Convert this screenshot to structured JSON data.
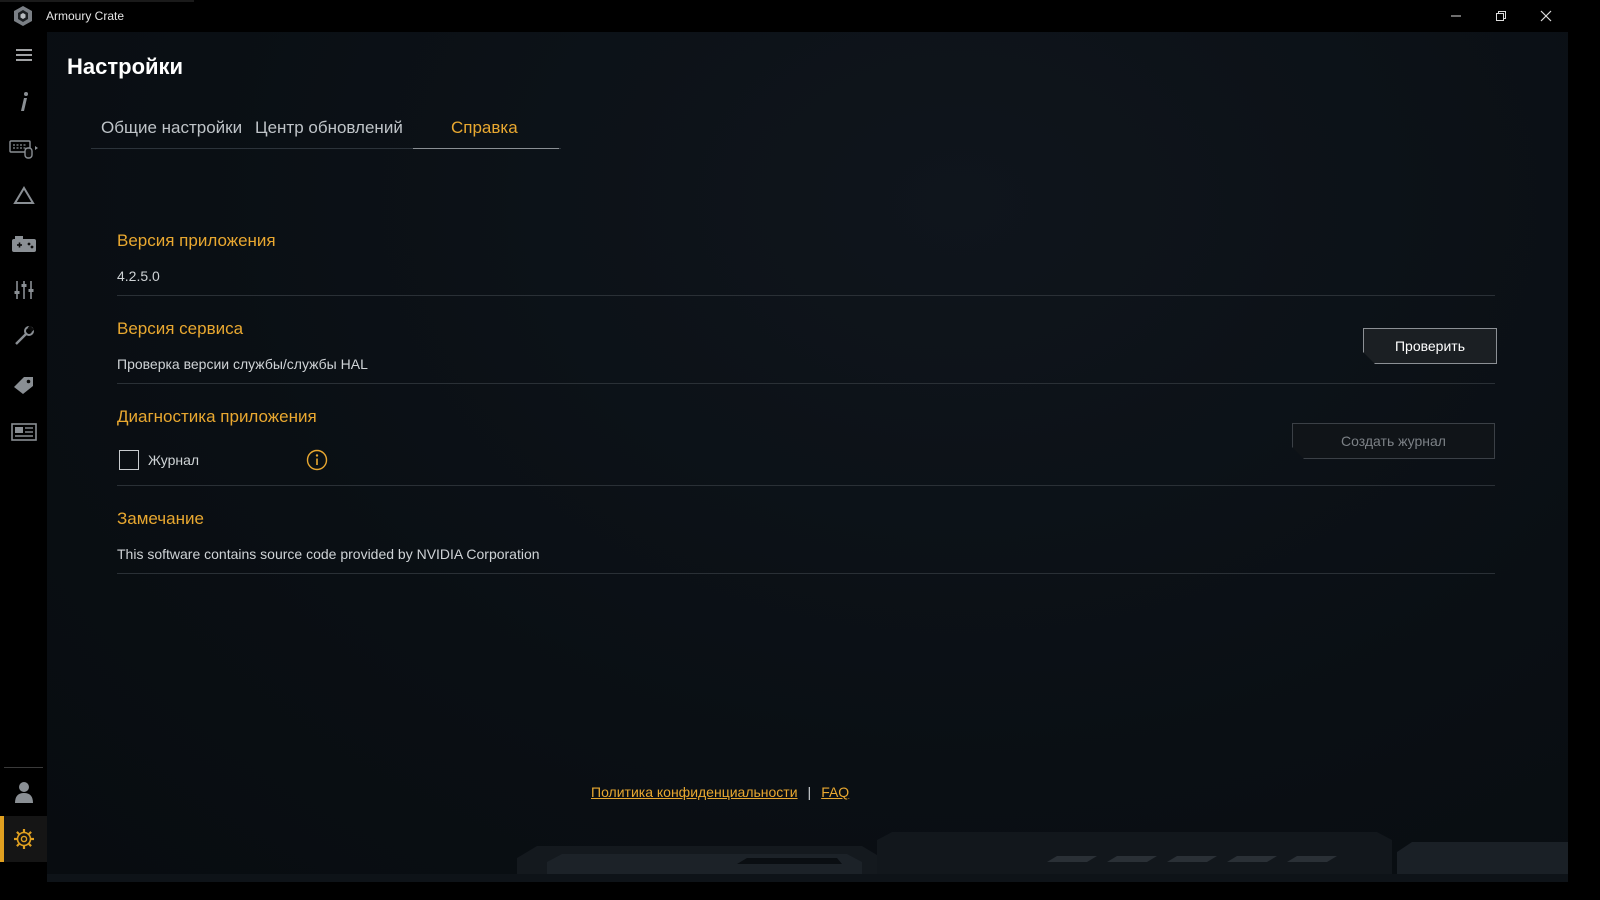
{
  "app": {
    "title": "Armoury Crate"
  },
  "window_controls": {
    "minimize_icon": "minimize-icon",
    "restore_icon": "restore-icon",
    "close_icon": "close-icon"
  },
  "sidebar": {
    "items": [
      {
        "icon": "menu-icon"
      },
      {
        "icon": "info-icon"
      },
      {
        "icon": "keyboard-devices-icon"
      },
      {
        "icon": "aura-icon"
      },
      {
        "icon": "game-library-icon"
      },
      {
        "icon": "settings-sliders-icon"
      },
      {
        "icon": "tools-icon"
      },
      {
        "icon": "deals-tag-icon"
      },
      {
        "icon": "news-icon"
      },
      {
        "icon": "user-icon"
      },
      {
        "icon": "gear-icon"
      }
    ],
    "active_item": "gear-icon"
  },
  "page": {
    "title": "Настройки",
    "tabs": [
      {
        "label": "Общие настройки",
        "active": false
      },
      {
        "label": "Центр обновлений",
        "active": false
      },
      {
        "label": "Справка",
        "active": true
      }
    ]
  },
  "sections": {
    "app_version": {
      "title": "Версия приложения",
      "value": "4.2.5.0"
    },
    "service_version": {
      "title": "Версия сервиса",
      "text": "Проверка версии службы/службы HAL",
      "button": "Проверить"
    },
    "diagnostics": {
      "title": "Диагностика приложения",
      "checkbox_label": "Журнал",
      "checkbox_checked": false,
      "button": "Создать журнал"
    },
    "notice": {
      "title": "Замечание",
      "text": "This software contains source code provided by NVIDIA Corporation"
    }
  },
  "footer": {
    "privacy": "Политика конфиденциальности",
    "separator": "|",
    "faq": "FAQ"
  },
  "colors": {
    "accent": "#e9a830",
    "background": "#0a0f14",
    "text": "#cfd3d6"
  }
}
